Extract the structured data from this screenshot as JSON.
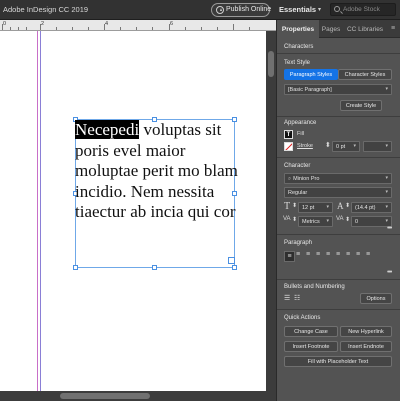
{
  "titlebar": {
    "app_title": "Adobe InDesign CC 2019",
    "publish_label": "Publish Online",
    "workspace": "Essentials",
    "stock_placeholder": "Adobe Stock"
  },
  "ruler": {
    "numbers": [
      "0",
      "2",
      "4",
      "6"
    ]
  },
  "document": {
    "selected_word": "Necepedi",
    "body_text": " voluptas sit poris evel maior moluptae perit mo blam incidio. Nem nessita tiaectur ab incia qui cor"
  },
  "panel": {
    "tabs": [
      "Properties",
      "Pages",
      "CC Libraries"
    ],
    "characters_title": "Characters",
    "text_style": {
      "title": "Text Style",
      "paragraph_styles": "Paragraph Styles",
      "character_styles": "Character Styles",
      "current_style": "[Basic Paragraph]",
      "create_style": "Create Style"
    },
    "appearance": {
      "title": "Appearance",
      "fill_label": "Fill",
      "stroke_label": "Stroke",
      "stroke_weight": "0 pt"
    },
    "character": {
      "title": "Character",
      "font_family": "Minion Pro",
      "font_style": "Regular",
      "font_size": "12 pt",
      "leading": "(14.4 pt)",
      "kerning": "Metrics",
      "tracking": "0"
    },
    "paragraph": {
      "title": "Paragraph"
    },
    "bullets": {
      "title": "Bullets and Numbering",
      "options_label": "Options"
    },
    "quick_actions": {
      "title": "Quick Actions",
      "change_case": "Change Case",
      "new_hyperlink": "New Hyperlink",
      "insert_footnote": "Insert Footnote",
      "insert_endnote": "Insert Endnote",
      "fill_placeholder": "Fill with Placeholder Text"
    }
  },
  "colors": {
    "accent": "#1473e6",
    "selection_frame": "#4a90e2",
    "margin_guide": "#c86fc8"
  }
}
